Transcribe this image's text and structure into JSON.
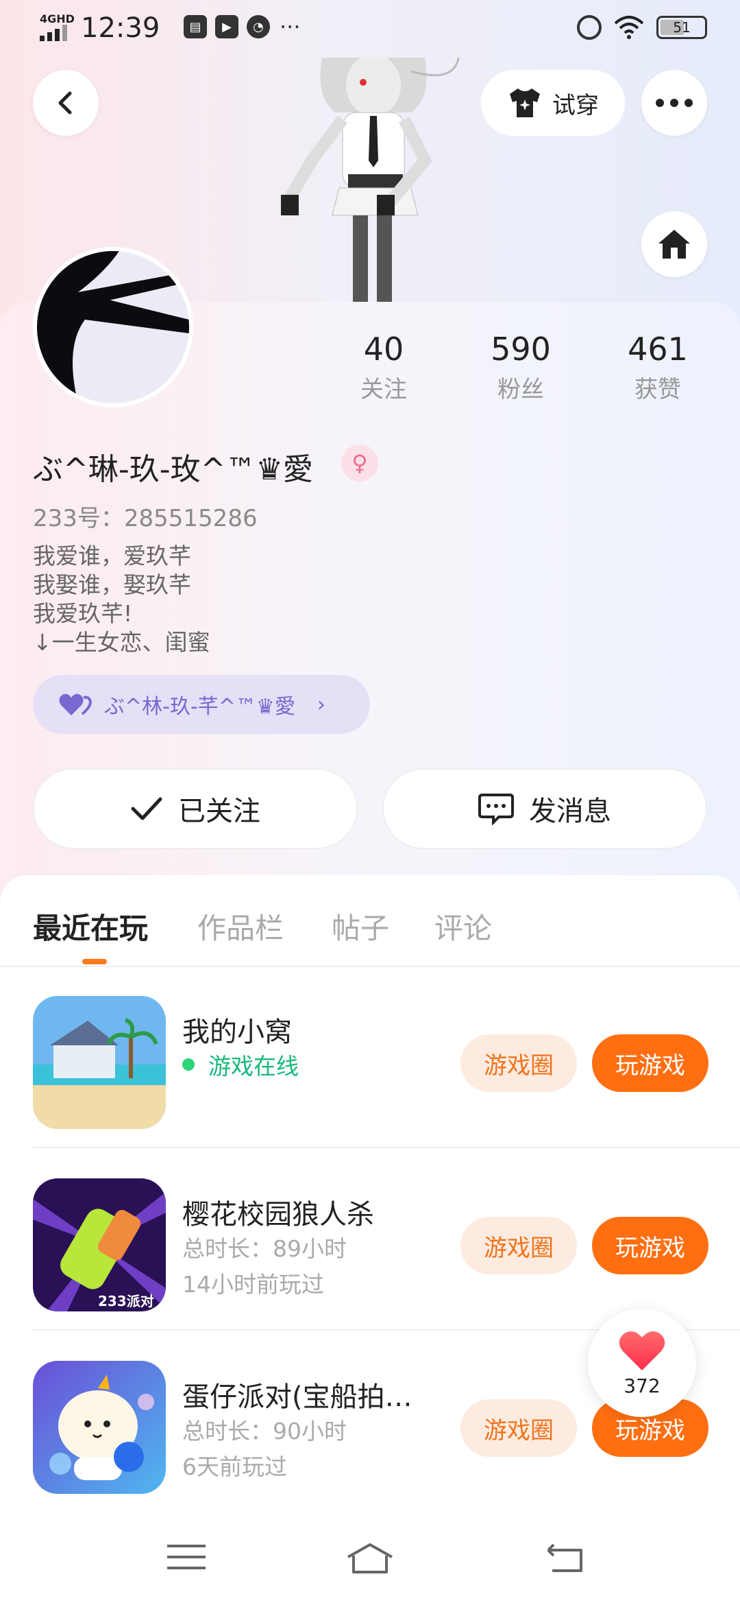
{
  "status_bar": {
    "network": "4GHD",
    "time": "12:39",
    "battery": "51"
  },
  "header": {
    "try_on_label": "试穿"
  },
  "profile": {
    "stats": [
      {
        "value": "40",
        "label": "关注"
      },
      {
        "value": "590",
        "label": "粉丝"
      },
      {
        "value": "461",
        "label": "获赞"
      }
    ],
    "nickname": "ぶ^琳-玖-玫^™♛愛",
    "gender_symbol": "♀",
    "uid": "233号：285515286",
    "bio_lines": [
      "我爱谁，爱玖芊",
      "我娶谁，娶玖芊",
      "我爱玖芊!",
      "↓一生女恋、闺蜜"
    ],
    "bond_label": "ぶ^林-玖-芊^™♛愛",
    "follow_label": "已关注",
    "message_label": "发消息"
  },
  "tabs": [
    "最近在玩",
    "作品栏",
    "帖子",
    "评论"
  ],
  "games": [
    {
      "name": "我的小窝",
      "status": "游戏在线",
      "circle_label": "游戏圈",
      "play_label": "玩游戏"
    },
    {
      "name": "樱花校园狼人杀",
      "duration": "总时长：89小时",
      "last_played": "14小时前玩过",
      "circle_label": "游戏圈",
      "play_label": "玩游戏"
    },
    {
      "name": "蛋仔派对(宝船拍…",
      "duration": "总时长：90小时",
      "last_played": "6天前玩过",
      "circle_label": "游戏圈",
      "play_label": "玩游戏"
    }
  ],
  "like_float": {
    "count": "372"
  },
  "colors": {
    "accent": "#ff6f12",
    "online": "#19b97c",
    "bond": "#7a67cf"
  }
}
